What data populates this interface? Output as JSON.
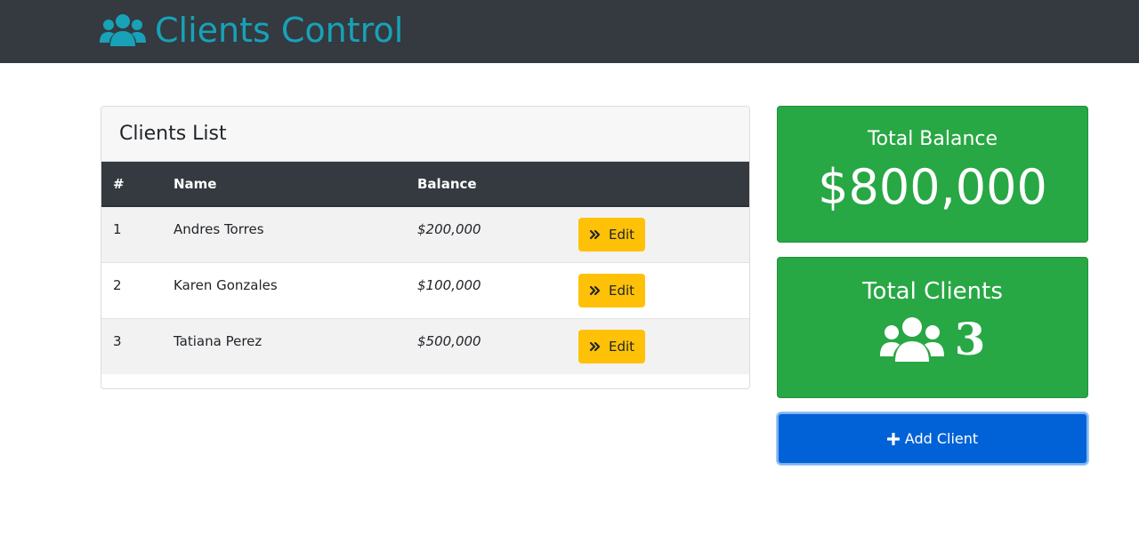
{
  "navbar": {
    "brand_icon": "users-icon",
    "brand_text": "Clients Control",
    "brand_color": "#17a2b8",
    "background": "#343a40"
  },
  "clients_card": {
    "title": "Clients List",
    "columns": [
      "#",
      "Name",
      "Balance",
      ""
    ],
    "rows": [
      {
        "index": "1",
        "name": "Andres Torres",
        "balance": "$200,000",
        "action_label": "Edit",
        "action_icon": "angle-double-right-icon"
      },
      {
        "index": "2",
        "name": "Karen Gonzales",
        "balance": "$100,000",
        "action_label": "Edit",
        "action_icon": "angle-double-right-icon"
      },
      {
        "index": "3",
        "name": "Tatiana Perez",
        "balance": "$500,000",
        "action_label": "Edit",
        "action_icon": "angle-double-right-icon"
      }
    ]
  },
  "total_balance": {
    "title": "Total Balance",
    "value": "$800,000",
    "color": "#28a745"
  },
  "total_clients": {
    "title": "Total Clients",
    "icon": "users-icon",
    "value": "3",
    "color": "#28a745"
  },
  "add_client": {
    "label": "Add Client",
    "icon": "plus-icon",
    "color": "#0062d6"
  }
}
